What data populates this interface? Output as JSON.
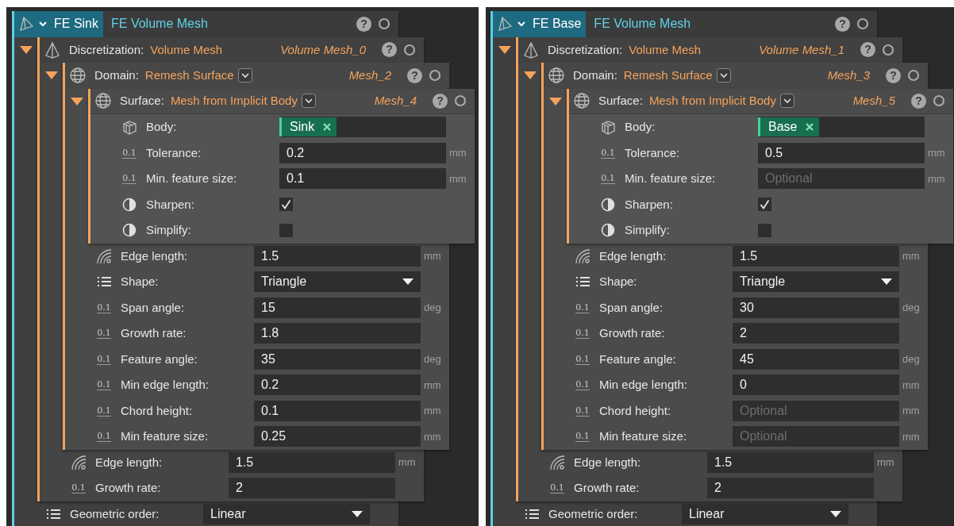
{
  "panels": [
    {
      "tab": "FE Sink",
      "type": "FE Volume Mesh",
      "expanded": true,
      "help": "?",
      "child": {
        "kind": "mesh",
        "label": "Discretization:",
        "value": "Volume Mesh",
        "instance": "Volume Mesh_0",
        "help": "?",
        "expanded": true,
        "child": {
          "kind": "region",
          "label": "Domain:",
          "value": "Remesh Surface",
          "dropdown": true,
          "instance": "Mesh_2",
          "help": "?",
          "expanded": true,
          "child": {
            "kind": "region",
            "label": "Surface:",
            "value": "Mesh from Implicit Body",
            "dropdown": true,
            "instance": "Mesh_4",
            "help": "?",
            "expanded": true,
            "fields": [
              {
                "kind": "reference",
                "label": "Body:",
                "value": "Sink"
              },
              {
                "kind": "number",
                "icon_text": "0.1",
                "label": "Tolerance:",
                "value": "0.2",
                "unit": "mm"
              },
              {
                "kind": "number",
                "icon_text": "0.1",
                "label": "Min. feature size:",
                "value": "0.1",
                "unit": "mm"
              },
              {
                "kind": "checkbox",
                "label": "Sharpen:",
                "checked": true
              },
              {
                "kind": "checkbox",
                "label": "Simplify:",
                "checked": false
              }
            ]
          },
          "fields": [
            {
              "kind": "length",
              "label": "Edge length:",
              "value": "1.5",
              "unit": "mm"
            },
            {
              "kind": "choice",
              "label": "Shape:",
              "value": "Triangle"
            },
            {
              "kind": "number",
              "icon_text": "0.1",
              "label": "Span angle:",
              "value": "15",
              "unit": "deg"
            },
            {
              "kind": "number",
              "icon_text": "0.1",
              "label": "Growth rate:",
              "value": "1.8"
            },
            {
              "kind": "number",
              "icon_text": "0.1",
              "label": "Feature angle:",
              "value": "35",
              "unit": "deg"
            },
            {
              "kind": "number",
              "icon_text": "0.1",
              "label": "Min edge length:",
              "value": "0.2",
              "unit": "mm"
            },
            {
              "kind": "number",
              "icon_text": "0.1",
              "label": "Chord height:",
              "value": "0.1",
              "unit": "mm"
            },
            {
              "kind": "number",
              "icon_text": "0.1",
              "label": "Min feature size:",
              "value": "0.25",
              "unit": "mm"
            }
          ]
        },
        "fields": [
          {
            "kind": "length",
            "label": "Edge length:",
            "value": "1.5",
            "unit": "mm"
          },
          {
            "kind": "number",
            "icon_text": "0.1",
            "label": "Growth rate:",
            "value": "2"
          }
        ]
      },
      "fields": [
        {
          "kind": "choice",
          "label": "Geometric order:",
          "value": "Linear"
        }
      ]
    },
    {
      "tab": "FE Base",
      "type": "FE Volume Mesh",
      "expanded": true,
      "help": "?",
      "child": {
        "kind": "mesh",
        "label": "Discretization:",
        "value": "Volume Mesh",
        "instance": "Volume Mesh_1",
        "help": "?",
        "expanded": true,
        "child": {
          "kind": "region",
          "label": "Domain:",
          "value": "Remesh Surface",
          "dropdown": true,
          "instance": "Mesh_3",
          "help": "?",
          "expanded": true,
          "child": {
            "kind": "region",
            "label": "Surface:",
            "value": "Mesh from Implicit Body",
            "dropdown": true,
            "instance": "Mesh_5",
            "help": "?",
            "expanded": true,
            "fields": [
              {
                "kind": "reference",
                "label": "Body:",
                "value": "Base"
              },
              {
                "kind": "number",
                "icon_text": "0.1",
                "label": "Tolerance:",
                "value": "0.5",
                "unit": "mm"
              },
              {
                "kind": "number",
                "icon_text": "0.1",
                "label": "Min. feature size:",
                "placeholder": "Optional",
                "unit": "mm"
              },
              {
                "kind": "checkbox",
                "label": "Sharpen:",
                "checked": true
              },
              {
                "kind": "checkbox",
                "label": "Simplify:",
                "checked": false
              }
            ]
          },
          "fields": [
            {
              "kind": "length",
              "label": "Edge length:",
              "value": "1.5",
              "unit": "mm"
            },
            {
              "kind": "choice",
              "label": "Shape:",
              "value": "Triangle"
            },
            {
              "kind": "number",
              "icon_text": "0.1",
              "label": "Span angle:",
              "value": "30",
              "unit": "deg"
            },
            {
              "kind": "number",
              "icon_text": "0.1",
              "label": "Growth rate:",
              "value": "2"
            },
            {
              "kind": "number",
              "icon_text": "0.1",
              "label": "Feature angle:",
              "value": "45",
              "unit": "deg"
            },
            {
              "kind": "number",
              "icon_text": "0.1",
              "label": "Min edge length:",
              "value": "0",
              "unit": "mm"
            },
            {
              "kind": "number",
              "icon_text": "0.1",
              "label": "Chord height:",
              "placeholder": "Optional",
              "unit": "mm"
            },
            {
              "kind": "number",
              "icon_text": "0.1",
              "label": "Min feature size:",
              "placeholder": "Optional",
              "unit": "mm"
            }
          ]
        },
        "fields": [
          {
            "kind": "length",
            "label": "Edge length:",
            "value": "1.5",
            "unit": "mm"
          },
          {
            "kind": "number",
            "icon_text": "0.1",
            "label": "Growth rate:",
            "value": "2"
          }
        ]
      },
      "fields": [
        {
          "kind": "choice",
          "label": "Geometric order:",
          "value": "Linear"
        }
      ]
    }
  ]
}
